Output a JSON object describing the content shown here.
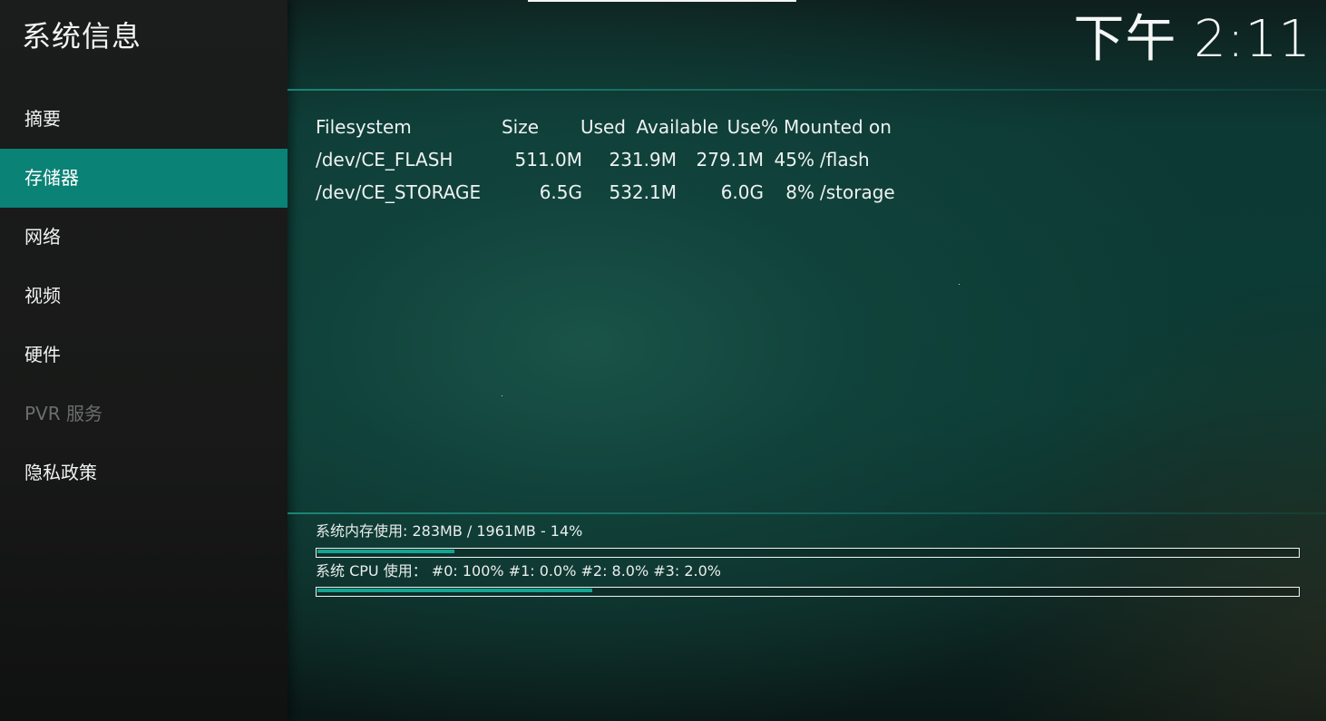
{
  "app": {
    "title": "系统信息",
    "clock": "下午 2:11"
  },
  "sidebar": {
    "items": [
      {
        "label": "摘要",
        "state": "normal"
      },
      {
        "label": "存储器",
        "state": "active"
      },
      {
        "label": "网络",
        "state": "normal"
      },
      {
        "label": "视频",
        "state": "normal"
      },
      {
        "label": "硬件",
        "state": "normal"
      },
      {
        "label": "PVR 服务",
        "state": "disabled"
      },
      {
        "label": "隐私政策",
        "state": "normal"
      }
    ]
  },
  "storage": {
    "columns": [
      "Filesystem",
      "Size",
      "Used",
      "Available",
      "Use%",
      "Mounted on"
    ],
    "rows": [
      [
        "/dev/CE_FLASH",
        "511.0M",
        "231.9M",
        "279.1M",
        "45%",
        "/flash"
      ],
      [
        "/dev/CE_STORAGE",
        "6.5G",
        "532.1M",
        "6.0G",
        "8%",
        "/storage"
      ]
    ]
  },
  "footer": {
    "memory_text": "系统内存使用: 283MB / 1961MB - 14%",
    "memory_percent": 14,
    "cpu_text": "系统 CPU 使用： #0: 100% #1: 0.0% #2: 8.0% #3: 2.0%",
    "cpu_percent": 28
  },
  "colors": {
    "accent": "#0a8275",
    "bar_fill": "#14a593"
  }
}
